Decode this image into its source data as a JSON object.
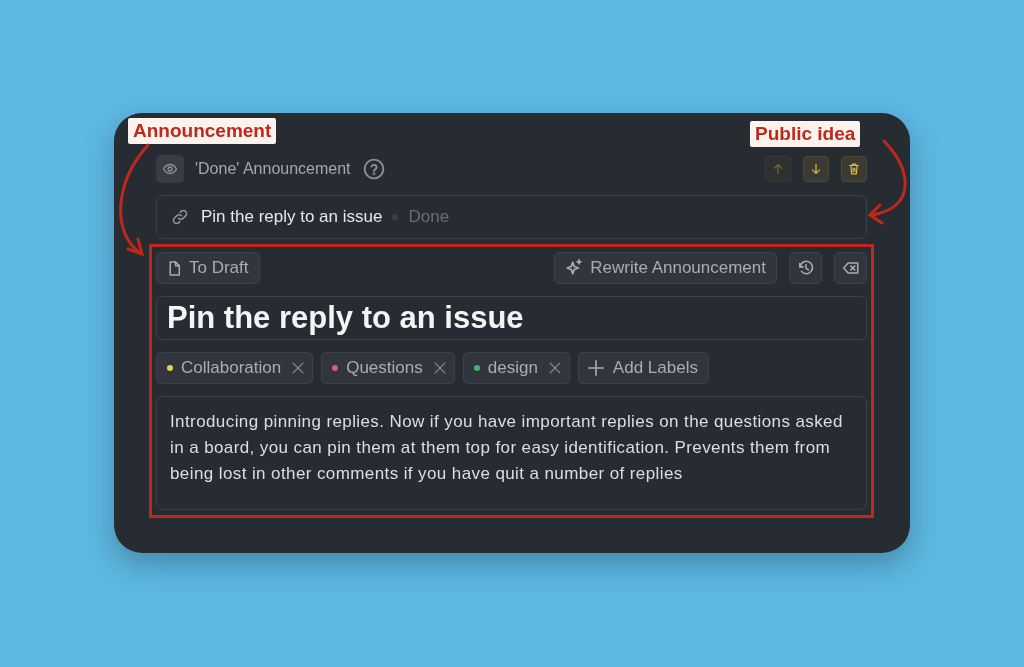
{
  "annotations": [
    {
      "text": "Announcement",
      "kind": "left"
    },
    {
      "text": "Public idea",
      "kind": "right"
    }
  ],
  "header": {
    "title": "'Done' Announcement",
    "visible": true,
    "buttons": [
      {
        "kind": "up",
        "disabled": true
      },
      {
        "kind": "down",
        "disabled": false
      },
      {
        "kind": "delete",
        "disabled": false
      }
    ]
  },
  "linked_idea": {
    "title": "Pin the reply to an issue",
    "status": "Done"
  },
  "editor": {
    "draft_button": "To Draft",
    "rewrite_button": "Rewrite Announcement",
    "title": "Pin the reply to an issue",
    "labels": [
      {
        "name": "Collaboration",
        "color": "#e8d44d"
      },
      {
        "name": "Questions",
        "color": "#e0568a"
      },
      {
        "name": "design",
        "color": "#4caf6a"
      }
    ],
    "add_labels": "Add Labels",
    "body": "Introducing pinning replies. Now if you have important replies on the questions asked in a board, you can pin them at them top for easy identification. Prevents them from being lost in other comments if you have quit a number of replies"
  }
}
